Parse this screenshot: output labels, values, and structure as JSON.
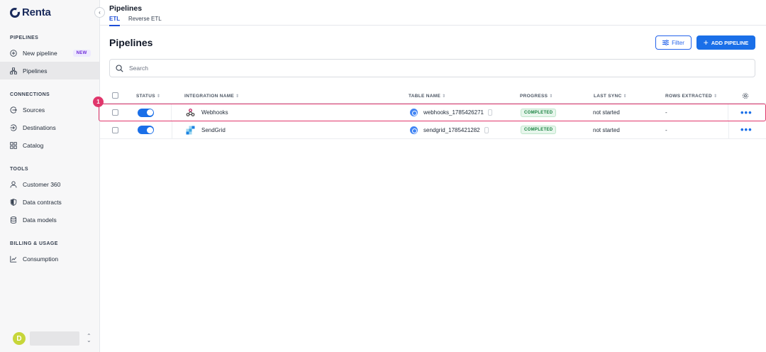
{
  "brand": {
    "name": "Renta"
  },
  "sidebar": {
    "sections": [
      {
        "label": "PIPELINES",
        "items": [
          {
            "label": "New pipeline",
            "icon": "plus-circle-icon",
            "badge": "NEW"
          },
          {
            "label": "Pipelines",
            "icon": "pipeline-icon",
            "active": true
          }
        ]
      },
      {
        "label": "CONNECTIONS",
        "items": [
          {
            "label": "Sources",
            "icon": "source-icon"
          },
          {
            "label": "Destinations",
            "icon": "destination-icon"
          },
          {
            "label": "Catalog",
            "icon": "grid-icon"
          }
        ]
      },
      {
        "label": "TOOLS",
        "items": [
          {
            "label": "Customer 360",
            "icon": "user-icon"
          },
          {
            "label": "Data contracts",
            "icon": "shield-icon"
          },
          {
            "label": "Data models",
            "icon": "database-icon"
          }
        ]
      },
      {
        "label": "BILLING & USAGE",
        "items": [
          {
            "label": "Consumption",
            "icon": "chart-icon"
          }
        ]
      }
    ],
    "user": {
      "initial": "D"
    }
  },
  "header": {
    "title": "Pipelines",
    "tabs": [
      {
        "label": "ETL",
        "active": true
      },
      {
        "label": "Reverse ETL",
        "active": false
      }
    ]
  },
  "main": {
    "title": "Pipelines",
    "filter_label": "Filter",
    "add_label": "ADD PIPELINE",
    "search_placeholder": "Search",
    "columns": [
      "STATUS",
      "INTEGRATION NAME",
      "TABLE NAME",
      "PROGRESS",
      "LAST SYNC",
      "ROWS EXTRACTED"
    ],
    "rows": [
      {
        "enabled": true,
        "integration": "Webhooks",
        "integration_icon": "webhook-icon",
        "table": "webhooks_1785426271",
        "progress": "COMPLETED",
        "last_sync": "not started",
        "rows_extracted": "-"
      },
      {
        "enabled": true,
        "integration": "SendGrid",
        "integration_icon": "sendgrid-icon",
        "table": "sendgrid_1785421282",
        "progress": "COMPLETED",
        "last_sync": "not started",
        "rows_extracted": "-"
      }
    ],
    "step_badge": "1"
  },
  "colors": {
    "accent": "#1a6fe8",
    "highlight": "#e0366b",
    "success": "#15803d"
  }
}
